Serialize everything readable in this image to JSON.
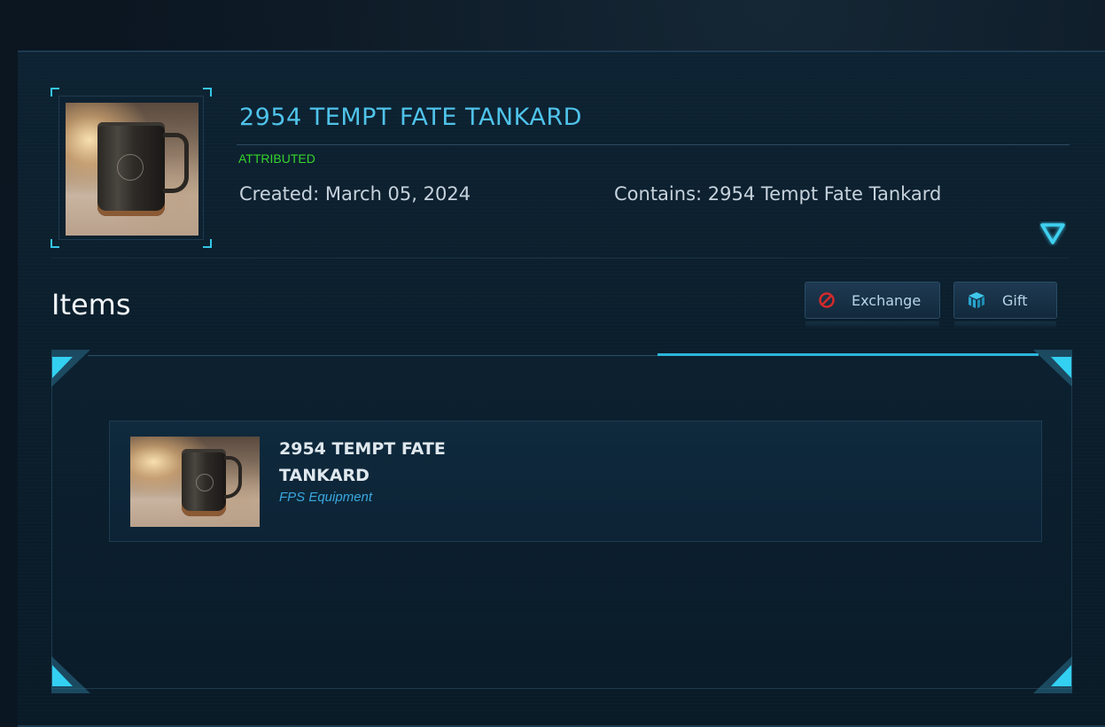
{
  "pledge": {
    "title": "2954 TEMPT FATE TANKARD",
    "status": "ATTRIBUTED",
    "created": "Created: March 05, 2024",
    "contains": "Contains: 2954 Tempt Fate Tankard",
    "image_icon": "tankard-thumbnail",
    "toggle_icon": "chevron-down-triangle-icon"
  },
  "items_section": {
    "heading": "Items",
    "actions": [
      {
        "label": "Exchange",
        "icon": "prohibited-icon",
        "icon_color": "#d42a2a"
      },
      {
        "label": "Gift",
        "icon": "gift-box-icon",
        "icon_color": "#2bb6db"
      }
    ],
    "items": [
      {
        "name": "2954 TEMPT FATE TANKARD",
        "type": "FPS Equipment",
        "image_icon": "tankard-thumbnail"
      }
    ]
  },
  "colors": {
    "accent": "#4fc3ea",
    "status_green": "#35d42b",
    "cyan_frame": "#2bb6db",
    "type_blue": "#3aa8e0"
  }
}
